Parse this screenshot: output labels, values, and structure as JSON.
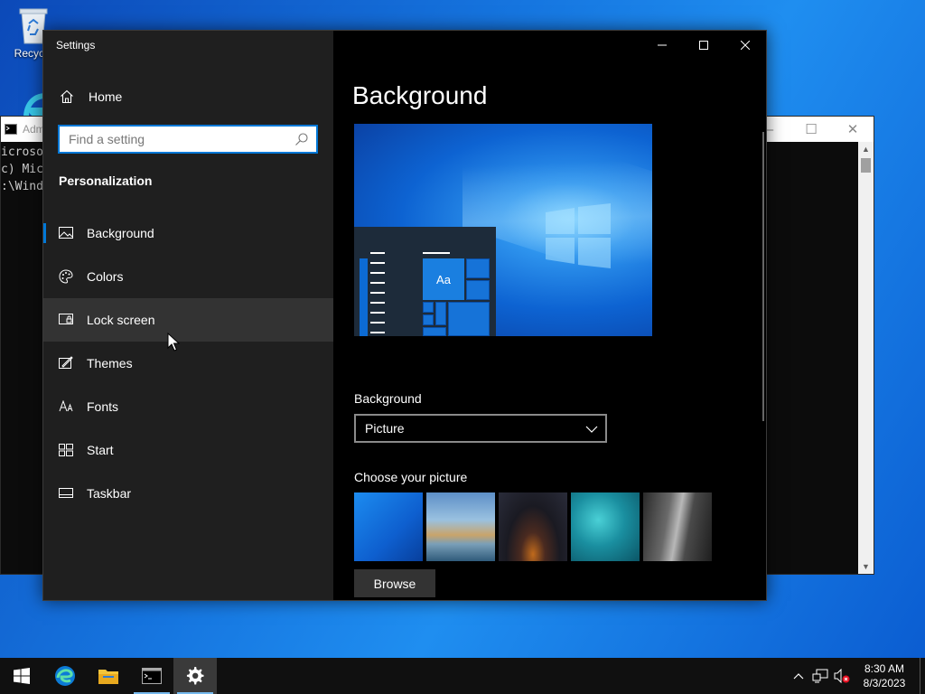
{
  "desktop": {
    "icons": [
      {
        "name": "recycle-bin",
        "label": "Recycle"
      }
    ]
  },
  "cmd_window": {
    "title": "Adm",
    "lines": [
      "icroso",
      "c) Mic",
      "",
      ":\\Wind"
    ]
  },
  "settings": {
    "window_title": "Settings",
    "home_label": "Home",
    "search_placeholder": "Find a setting",
    "section": "Personalization",
    "nav": [
      {
        "label": "Background",
        "icon": "picture-icon",
        "selected": true
      },
      {
        "label": "Colors",
        "icon": "palette-icon"
      },
      {
        "label": "Lock screen",
        "icon": "lock-screen-icon",
        "hover": true
      },
      {
        "label": "Themes",
        "icon": "themes-icon"
      },
      {
        "label": "Fonts",
        "icon": "fonts-icon"
      },
      {
        "label": "Start",
        "icon": "start-icon"
      },
      {
        "label": "Taskbar",
        "icon": "taskbar-icon"
      }
    ],
    "page_title": "Background",
    "preview_tile_text": "Aa",
    "background_label": "Background",
    "background_value": "Picture",
    "choose_picture_label": "Choose your picture",
    "browse_label": "Browse"
  },
  "taskbar": {
    "apps": [
      "start-icon",
      "edge-icon",
      "file-explorer-icon",
      "cmd-icon",
      "settings-icon"
    ],
    "time": "8:30 AM",
    "date": "8/3/2023"
  },
  "colors": {
    "accent": "#0078d7",
    "nav_bg": "#1f1f1f",
    "content_bg": "#000000",
    "taskbar_bg": "#101010"
  }
}
